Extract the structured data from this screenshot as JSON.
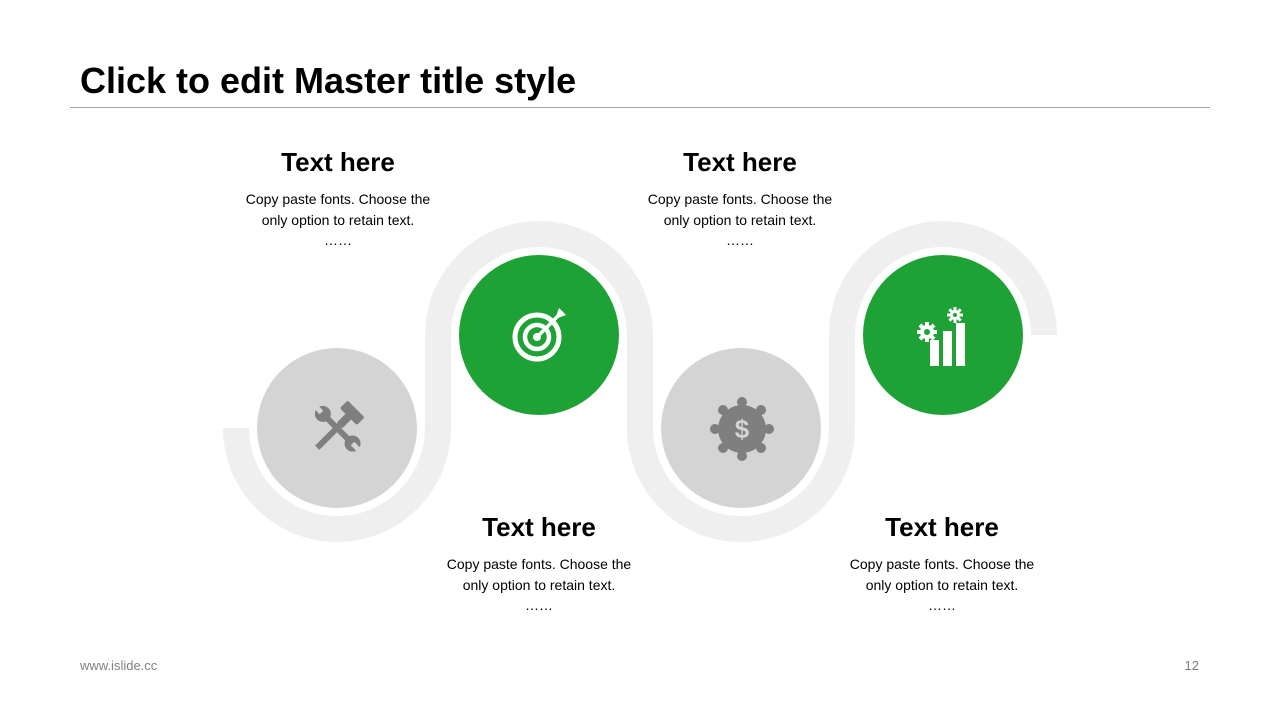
{
  "slide": {
    "title": "Click to edit Master title style",
    "footer_left": "www.islide.cc",
    "page_number": "12"
  },
  "colors": {
    "accent": "#1fa235",
    "inactive": "#d4d4d4",
    "track": "#efefef",
    "inactive_icon": "#7f7f7f"
  },
  "steps": [
    {
      "heading": "Text here",
      "body": "Copy paste fonts. Choose the\nonly option to retain text.",
      "dots": "……",
      "icon": "tools-icon",
      "active": false
    },
    {
      "heading": "Text here",
      "body": "Copy paste fonts. Choose the\nonly option to retain text.",
      "dots": "……",
      "icon": "target-icon",
      "active": true
    },
    {
      "heading": "Text here",
      "body": "Copy paste fonts. Choose the\nonly option to retain text.",
      "dots": "……",
      "icon": "dollar-badge-icon",
      "active": false
    },
    {
      "heading": "Text here",
      "body": "Copy paste fonts. Choose the\nonly option to retain text.",
      "dots": "……",
      "icon": "growth-chart-icon",
      "active": true
    }
  ]
}
